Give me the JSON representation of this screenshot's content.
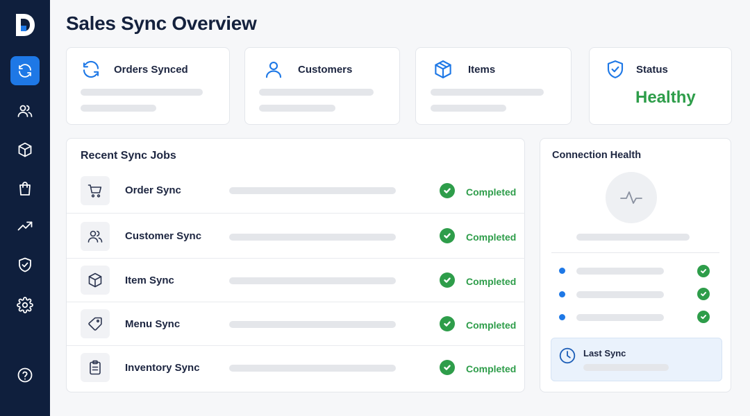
{
  "app": {
    "title": "Sales Sync Overview"
  },
  "colors": {
    "sidebar_bg": "#0f1f3d",
    "accent": "#1e78e6",
    "success": "#2e9d4a"
  },
  "sidebar": {
    "logo_icon": "logo-d-icon",
    "items": [
      {
        "icon": "sync-icon",
        "active": true
      },
      {
        "icon": "users-icon"
      },
      {
        "icon": "box-icon"
      },
      {
        "icon": "shopping-bag-icon"
      },
      {
        "icon": "trending-up-icon"
      },
      {
        "icon": "shield-check-icon"
      },
      {
        "icon": "gear-icon"
      },
      {
        "icon": "help-icon"
      }
    ]
  },
  "stats": [
    {
      "label": "Orders Synced",
      "icon": "sync-icon"
    },
    {
      "label": "Customers",
      "icon": "user-icon"
    },
    {
      "label": "Items",
      "icon": "box-icon"
    },
    {
      "label": "Status",
      "icon": "shield-check-icon",
      "value": "Healthy"
    }
  ],
  "jobs": {
    "title": "Recent Sync Jobs",
    "rows": [
      {
        "name": "Order Sync",
        "icon": "cart-icon",
        "status": "Completed"
      },
      {
        "name": "Customer Sync",
        "icon": "users-icon",
        "status": "Completed"
      },
      {
        "name": "Item Sync",
        "icon": "box-icon",
        "status": "Completed"
      },
      {
        "name": "Menu Sync",
        "icon": "tag-icon",
        "status": "Completed"
      },
      {
        "name": "Inventory Sync",
        "icon": "clipboard-icon",
        "status": "Completed"
      }
    ]
  },
  "health": {
    "title": "Connection Health",
    "pulse_icon": "activity-icon",
    "last_sync_label": "Last Sync",
    "last_sync_icon": "clock-icon"
  }
}
